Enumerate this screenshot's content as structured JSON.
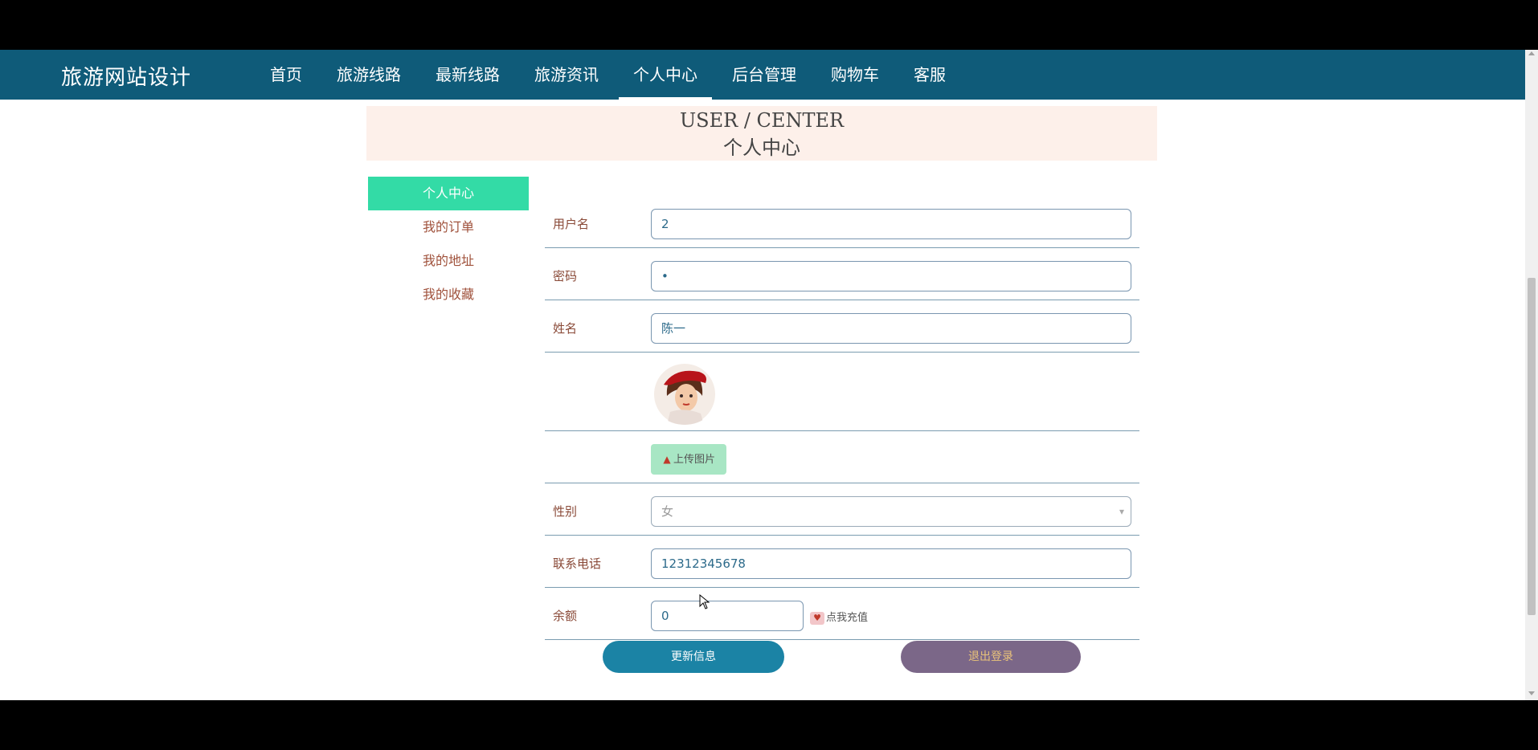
{
  "navbar": {
    "title": "旅游网站设计",
    "items": [
      {
        "label": "首页"
      },
      {
        "label": "旅游线路"
      },
      {
        "label": "最新线路"
      },
      {
        "label": "旅游资讯"
      },
      {
        "label": "个人中心",
        "active": true
      },
      {
        "label": "后台管理"
      },
      {
        "label": "购物车"
      },
      {
        "label": "客服"
      }
    ]
  },
  "banner": {
    "en": "USER / CENTER",
    "cn": "个人中心"
  },
  "sidebar": {
    "items": [
      {
        "label": "个人中心",
        "active": true
      },
      {
        "label": "我的订单"
      },
      {
        "label": "我的地址"
      },
      {
        "label": "我的收藏"
      }
    ]
  },
  "form": {
    "username": {
      "label": "用户名",
      "value": "2"
    },
    "password": {
      "label": "密码",
      "value": "•"
    },
    "name": {
      "label": "姓名",
      "value": "陈一"
    },
    "avatar": {
      "icon": "user-avatar-image"
    },
    "upload": {
      "label": "上传图片",
      "icon": "upload-icon"
    },
    "gender": {
      "label": "性别",
      "value": "女"
    },
    "phone": {
      "label": "联系电话",
      "value": "12312345678"
    },
    "balance": {
      "label": "余额",
      "value": "0",
      "recharge_label": "点我充值"
    }
  },
  "actions": {
    "update": "更新信息",
    "logout": "退出登录"
  },
  "colors": {
    "navbar": "#0f5b79",
    "sidebar_active": "#33dba6",
    "update_button": "#1b83a5",
    "logout_button": "#7b6788"
  }
}
